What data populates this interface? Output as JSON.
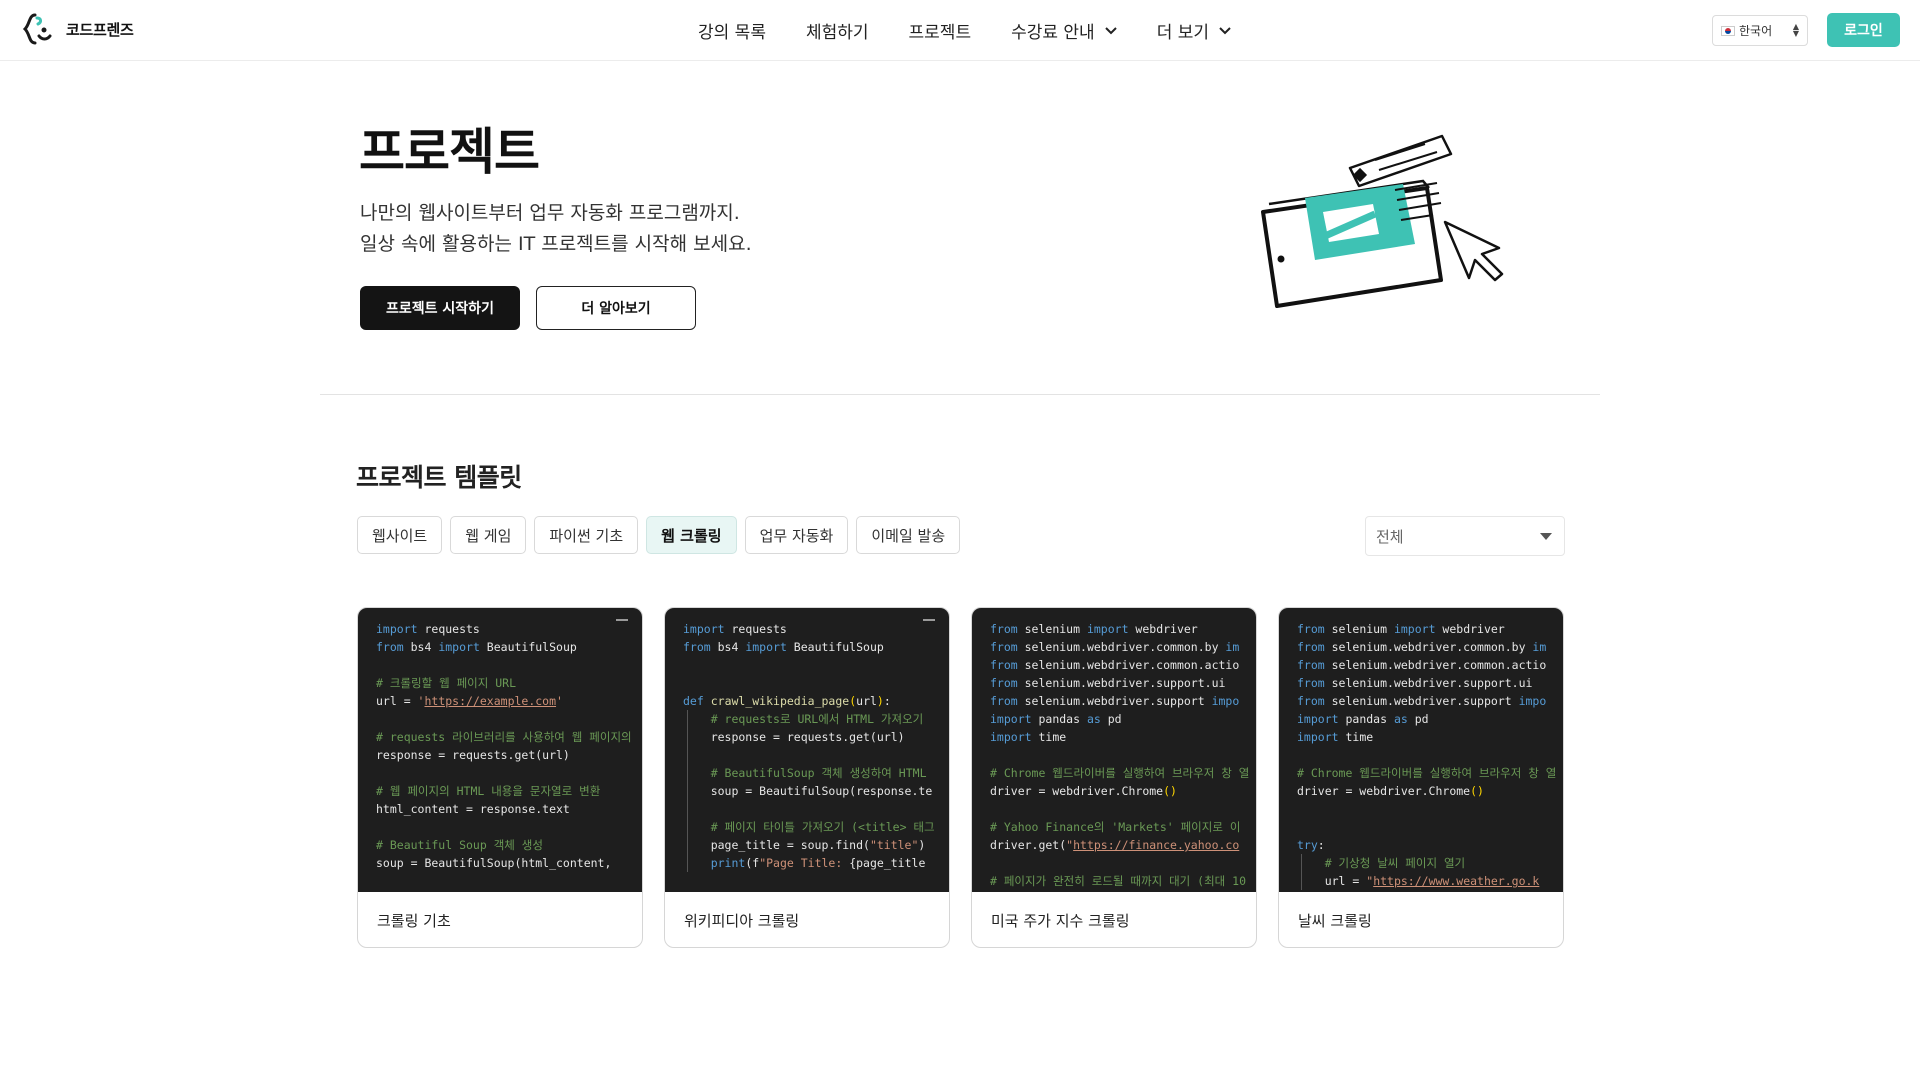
{
  "header": {
    "brand": "코드프렌즈",
    "nav": [
      {
        "label": "강의 목록",
        "has_dropdown": false
      },
      {
        "label": "체험하기",
        "has_dropdown": false
      },
      {
        "label": "프로젝트",
        "has_dropdown": false
      },
      {
        "label": "수강료 안내",
        "has_dropdown": true
      },
      {
        "label": "더 보기",
        "has_dropdown": true
      }
    ],
    "language": "한국어",
    "login_label": "로그인",
    "accent_color": "#3ec2b4"
  },
  "hero": {
    "title": "프로젝트",
    "desc_line1": "나만의 웹사이트부터 업무 자동화 프로그램까지.",
    "desc_line2": "일상 속에 활용하는 IT 프로젝트를 시작해 보세요.",
    "primary_button": "프로젝트 시작하기",
    "secondary_button": "더 알아보기"
  },
  "templates": {
    "title": "프로젝트 템플릿",
    "filters": [
      {
        "label": "웹사이트",
        "active": false
      },
      {
        "label": "웹 게임",
        "active": false
      },
      {
        "label": "파이썬 기초",
        "active": false
      },
      {
        "label": "웹 크롤링",
        "active": true
      },
      {
        "label": "업무 자동화",
        "active": false
      },
      {
        "label": "이메일 발송",
        "active": false
      }
    ],
    "sort_selected": "전체",
    "cards": [
      {
        "label": "크롤링 기초",
        "collapse": true,
        "code": [
          [
            [
              "kw",
              "import"
            ],
            [
              "t",
              " requests"
            ]
          ],
          [
            [
              "kw",
              "from"
            ],
            [
              "t",
              " bs4 "
            ],
            [
              "kw",
              "import"
            ],
            [
              "t",
              " BeautifulSoup"
            ]
          ],
          [],
          [
            [
              "cm",
              "# 크롤링할 웹 페이지 URL"
            ]
          ],
          [
            [
              "t",
              "url = "
            ],
            [
              "st",
              "'"
            ],
            [
              "lk",
              "https://example.com"
            ],
            [
              "st",
              "'"
            ]
          ],
          [],
          [
            [
              "cm",
              "# requests 라이브러리를 사용하여 웹 페이지의"
            ]
          ],
          [
            [
              "t",
              "response = requests.get(url)"
            ]
          ],
          [],
          [
            [
              "cm",
              "# 웹 페이지의 HTML 내용을 문자열로 변환"
            ]
          ],
          [
            [
              "t",
              "html_content = response.text"
            ]
          ],
          [],
          [
            [
              "cm",
              "# Beautiful Soup 객체 생성"
            ]
          ],
          [
            [
              "t",
              "soup = BeautifulSoup(html_content,"
            ]
          ]
        ]
      },
      {
        "label": "위키피디아 크롤링",
        "collapse": true,
        "code": [
          [
            [
              "kw",
              "import"
            ],
            [
              "t",
              " requests"
            ]
          ],
          [
            [
              "kw",
              "from"
            ],
            [
              "t",
              " bs4 "
            ],
            [
              "kw",
              "import"
            ],
            [
              "t",
              " BeautifulSoup"
            ]
          ],
          [],
          [],
          [
            [
              "kw",
              "def"
            ],
            [
              "t",
              " "
            ],
            [
              "fn",
              "crawl_wikipedia_page"
            ],
            [
              "pr",
              "("
            ],
            [
              "t",
              "url"
            ],
            [
              "pr",
              ")"
            ],
            [
              "t",
              ":"
            ]
          ],
          [
            [
              "t",
              "    "
            ],
            [
              "cm",
              "# requests로 URL에서 HTML 가져오기"
            ]
          ],
          [
            [
              "t",
              "    response = requests.get(url)"
            ]
          ],
          [],
          [
            [
              "t",
              "    "
            ],
            [
              "cm",
              "# BeautifulSoup 객체 생성하여 HTML"
            ]
          ],
          [
            [
              "t",
              "    soup = BeautifulSoup(response.te"
            ]
          ],
          [],
          [
            [
              "t",
              "    "
            ],
            [
              "cm",
              "# 페이지 타이틀 가져오기 (<title> 태그"
            ]
          ],
          [
            [
              "t",
              "    page_title = soup.find("
            ],
            [
              "st",
              "\"title\""
            ],
            [
              "t",
              ")"
            ]
          ],
          [
            [
              "t",
              "    "
            ],
            [
              "kw",
              "print"
            ],
            [
              "t",
              "(f"
            ],
            [
              "st",
              "\"Page Title: "
            ],
            [
              "t",
              "{page_title"
            ]
          ]
        ]
      },
      {
        "label": "미국 주가 지수 크롤링",
        "collapse": false,
        "code": [
          [
            [
              "kw",
              "from"
            ],
            [
              "t",
              " selenium "
            ],
            [
              "kw",
              "import"
            ],
            [
              "t",
              " webdriver"
            ]
          ],
          [
            [
              "kw",
              "from"
            ],
            [
              "t",
              " selenium.webdriver.common.by "
            ],
            [
              "kw",
              "im"
            ]
          ],
          [
            [
              "kw",
              "from"
            ],
            [
              "t",
              " selenium.webdriver.common.actio"
            ]
          ],
          [
            [
              "kw",
              "from"
            ],
            [
              "t",
              " selenium.webdriver.support.ui "
            ]
          ],
          [
            [
              "kw",
              "from"
            ],
            [
              "t",
              " selenium.webdriver.support "
            ],
            [
              "kw",
              "impo"
            ]
          ],
          [
            [
              "kw",
              "import"
            ],
            [
              "t",
              " pandas "
            ],
            [
              "kw",
              "as"
            ],
            [
              "t",
              " pd"
            ]
          ],
          [
            [
              "kw",
              "import"
            ],
            [
              "t",
              " time"
            ]
          ],
          [],
          [
            [
              "cm",
              "# Chrome 웹드라이버를 실행하여 브라우저 창 열"
            ]
          ],
          [
            [
              "t",
              "driver = webdriver.Chrome"
            ],
            [
              "pr",
              "()"
            ]
          ],
          [],
          [
            [
              "cm",
              "# Yahoo Finance의 'Markets' 페이지로 이"
            ]
          ],
          [
            [
              "t",
              "driver.get("
            ],
            [
              "st",
              "\""
            ],
            [
              "lk",
              "https://finance.yahoo.co"
            ]
          ],
          [],
          [
            [
              "cm",
              "# 페이지가 완전히 로드될 때까지 대기 (최대 10"
            ]
          ]
        ]
      },
      {
        "label": "날씨 크롤링",
        "collapse": false,
        "code": [
          [
            [
              "kw",
              "from"
            ],
            [
              "t",
              " selenium "
            ],
            [
              "kw",
              "import"
            ],
            [
              "t",
              " webdriver"
            ]
          ],
          [
            [
              "kw",
              "from"
            ],
            [
              "t",
              " selenium.webdriver.common.by "
            ],
            [
              "kw",
              "im"
            ]
          ],
          [
            [
              "kw",
              "from"
            ],
            [
              "t",
              " selenium.webdriver.common.actio"
            ]
          ],
          [
            [
              "kw",
              "from"
            ],
            [
              "t",
              " selenium.webdriver.support.ui "
            ]
          ],
          [
            [
              "kw",
              "from"
            ],
            [
              "t",
              " selenium.webdriver.support "
            ],
            [
              "kw",
              "impo"
            ]
          ],
          [
            [
              "kw",
              "import"
            ],
            [
              "t",
              " pandas "
            ],
            [
              "kw",
              "as"
            ],
            [
              "t",
              " pd"
            ]
          ],
          [
            [
              "kw",
              "import"
            ],
            [
              "t",
              " time"
            ]
          ],
          [],
          [
            [
              "cm",
              "# Chrome 웹드라이버를 실행하여 브라우저 창 열"
            ]
          ],
          [
            [
              "t",
              "driver = webdriver.Chrome"
            ],
            [
              "pr",
              "()"
            ]
          ],
          [],
          [],
          [
            [
              "kw",
              "try"
            ],
            [
              "t",
              ":"
            ]
          ],
          [
            [
              "t",
              "    "
            ],
            [
              "cm",
              "# 기상청 날씨 페이지 열기"
            ]
          ],
          [
            [
              "t",
              "    url = "
            ],
            [
              "st",
              "\""
            ],
            [
              "lk",
              "https://www.weather.go.k"
            ]
          ]
        ]
      }
    ]
  }
}
